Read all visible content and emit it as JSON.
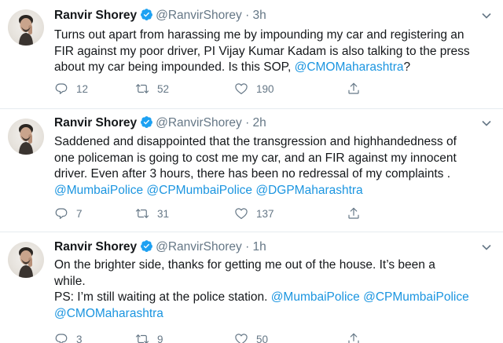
{
  "colors": {
    "link": "#1b95e0",
    "muted": "#657786",
    "verified": "#1da1f2",
    "text": "#14171a"
  },
  "tweets": [
    {
      "name": "Ranvir Shorey",
      "handle": "@RanvirShorey",
      "dot": "·",
      "time": "3h",
      "lines": [
        [
          {
            "t": "Turns out apart from harassing me by impounding my car and registering an"
          }
        ],
        [
          {
            "t": "FIR against my poor driver, PI Vijay Kumar Kadam is also talking to the press"
          }
        ],
        [
          {
            "t": "about my car being impounded. Is this SOP, "
          },
          {
            "t": "@CMOMaharashtra",
            "m": true
          },
          {
            "t": "?"
          }
        ]
      ],
      "replies": "12",
      "retweets": "52",
      "likes": "190"
    },
    {
      "name": "Ranvir Shorey",
      "handle": "@RanvirShorey",
      "dot": "·",
      "time": "2h",
      "lines": [
        [
          {
            "t": "Saddened and disappointed that the transgression and highhandedness of"
          }
        ],
        [
          {
            "t": "one policeman is going to cost me my car, and an FIR against my innocent"
          }
        ],
        [
          {
            "t": "driver. Even after 3 hours, there has been no redressal of my complaints ."
          }
        ],
        [
          {
            "t": "@MumbaiPolice",
            "m": true
          },
          {
            "t": " "
          },
          {
            "t": "@CPMumbaiPolice",
            "m": true
          },
          {
            "t": " "
          },
          {
            "t": "@DGPMaharashtra",
            "m": true
          }
        ]
      ],
      "replies": "7",
      "retweets": "31",
      "likes": "137"
    },
    {
      "name": "Ranvir Shorey",
      "handle": "@RanvirShorey",
      "dot": "·",
      "time": "1h",
      "lines": [
        [
          {
            "t": "On the brighter side, thanks for getting me out of the house. It’s been a"
          }
        ],
        [
          {
            "t": "while."
          }
        ],
        [
          {
            "t": "PS: I’m still waiting at the police station. "
          },
          {
            "t": "@MumbaiPolice",
            "m": true
          },
          {
            "t": " "
          },
          {
            "t": "@CPMumbaiPolice",
            "m": true
          }
        ],
        [
          {
            "t": "@CMOMaharashtra",
            "m": true
          }
        ]
      ],
      "replies": "3",
      "retweets": "9",
      "likes": "50"
    }
  ]
}
